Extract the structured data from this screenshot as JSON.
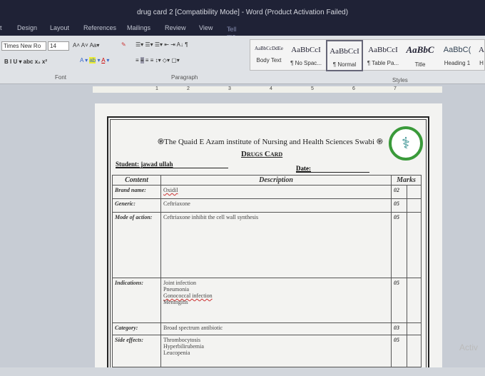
{
  "window": {
    "title": "drug card 2 [Compatibility Mode] - Word (Product Activation Failed)"
  },
  "tabs": [
    "t",
    "Design",
    "Layout",
    "References",
    "Mailings",
    "Review",
    "View"
  ],
  "tell_me": "Tell me what you want to do...",
  "font": {
    "name": "Times New Ro",
    "size": "14",
    "group": "Font"
  },
  "paragraph_group": "Paragraph",
  "styles_group": "Styles",
  "styles": [
    {
      "preview": "AaBbCcDdEe",
      "label": "Body Text"
    },
    {
      "preview": "AaBbCcI",
      "label": "¶ No Spac..."
    },
    {
      "preview": "AaBbCcI",
      "label": "¶ Normal"
    },
    {
      "preview": "AaBbCcI",
      "label": "¶ Table Pa..."
    },
    {
      "preview": "AaBbC",
      "label": "Title"
    },
    {
      "preview": "AaBbC(",
      "label": "Heading 1"
    },
    {
      "preview": "A",
      "label": "H"
    }
  ],
  "ruler": [
    "1",
    "2",
    "3",
    "4",
    "5",
    "6",
    "7"
  ],
  "doc": {
    "institute": "֍The Quaid E Azam institute of Nursing and Health Sciences Swabi ֍",
    "heading": "Drugs Card",
    "student": "Student: jawad ullah",
    "date": "Date:",
    "headers": [
      "Content",
      "Description",
      "Marks"
    ],
    "rows": [
      {
        "k": "Brand name:",
        "d": [
          "Oxidil"
        ],
        "m": "02"
      },
      {
        "k": "Generic:",
        "d": [
          "Ceftriaxone"
        ],
        "m": "05"
      },
      {
        "k": "Mode of action:",
        "d": [
          "Ceftriaxone  inhibit the cell wall synthesis"
        ],
        "m": "05"
      },
      {
        "k": "Indications:",
        "d": [
          "Joint infection",
          "Pneumonia",
          "Gonococcal infection",
          "Meningitis"
        ],
        "m": "05"
      },
      {
        "k": "Category:",
        "d": [
          "Broad spectrum antibiotic"
        ],
        "m": "03"
      },
      {
        "k": "Side effects:",
        "d": [
          "Thrombocytosis",
          "Hyperbilirubemia",
          "Leucopenia"
        ],
        "m": "05"
      }
    ]
  },
  "activation": "Activ"
}
